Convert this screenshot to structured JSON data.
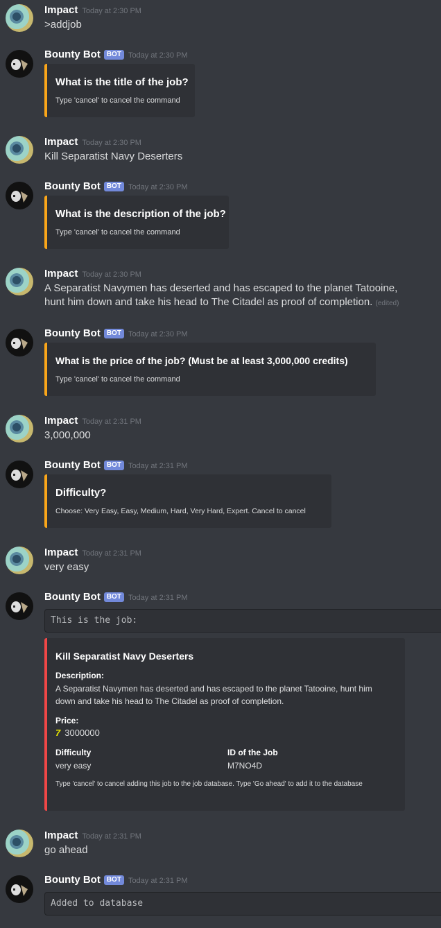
{
  "users": {
    "impact": "Impact",
    "bot": "Bounty Bot",
    "bot_tag": "BOT"
  },
  "messages": {
    "m1": {
      "ts": "Today at 2:30 PM",
      "text": ">addjob"
    },
    "m2": {
      "ts": "Today at 2:30 PM",
      "title": "What is the title of the job?",
      "footer": "Type 'cancel' to cancel the command"
    },
    "m3": {
      "ts": "Today at 2:30 PM",
      "text": "Kill Separatist Navy Deserters"
    },
    "m4": {
      "ts": "Today at 2:30 PM",
      "title": "What is the description of the job?",
      "footer": "Type 'cancel' to cancel the command"
    },
    "m5": {
      "ts": "Today at 2:30 PM",
      "text": "A Separatist Navymen has deserted and has escaped to the planet Tatooine, hunt him down and take his head to The Citadel as proof of completion.",
      "edited": "(edited)"
    },
    "m6": {
      "ts": "Today at 2:30 PM",
      "title": "What is the price of the job? (Must be at least 3,000,000 credits)",
      "footer": "Type 'cancel' to cancel the command"
    },
    "m7": {
      "ts": "Today at 2:31 PM",
      "text": "3,000,000"
    },
    "m8": {
      "ts": "Today at 2:31 PM",
      "title": "Difficulty?",
      "footer": "Choose: Very Easy, Easy, Medium, Hard, Very Hard, Expert. Cancel to cancel"
    },
    "m9": {
      "ts": "Today at 2:31 PM",
      "text": "very easy"
    },
    "m10": {
      "ts": "Today at 2:31 PM",
      "code": "This is the job:",
      "embed": {
        "title": "Kill Separatist Navy Deserters",
        "desc_name": "Description:",
        "desc_value": "A Separatist Navymen has deserted and has escaped to the planet Tatooine, hunt him down and take his head to The Citadel as proof of completion.",
        "price_name": "Price:",
        "price_icon": "7",
        "price_value": "3000000",
        "difficulty_name": "Difficulty",
        "difficulty_value": "very easy",
        "id_name": "ID of the Job",
        "id_value": "M7NO4D",
        "footer": "Type 'cancel' to cancel adding this job to the job database. Type 'Go ahead' to add it to the database"
      }
    },
    "m11": {
      "ts": "Today at 2:31 PM",
      "text": "go ahead"
    },
    "m12": {
      "ts": "Today at 2:31 PM",
      "code": "Added to database"
    }
  },
  "colors": {
    "background": "#36393f",
    "embed_bg": "#2f3136",
    "embed_accent_orange": "#faa61a",
    "embed_accent_red": "#f04747",
    "bot_tag": "#7289da"
  }
}
